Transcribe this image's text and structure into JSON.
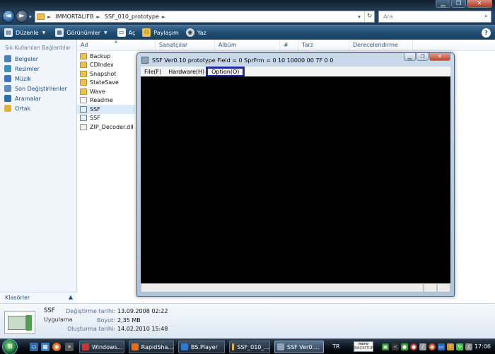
{
  "window": {
    "minimize": "▁",
    "maximize": "❐",
    "close": "✕"
  },
  "address": {
    "crumbs": [
      "IMMORTALIFB",
      "SSF_010_prototype"
    ],
    "arrow": "►",
    "dropdown": "▾",
    "refresh": "↻"
  },
  "search": {
    "placeholder": "Ara",
    "icon": "magnifier-icon"
  },
  "nav_buttons": {
    "back": "◄",
    "forward": "►",
    "history": "▾"
  },
  "toolbar": {
    "organize": "Düzenle",
    "views": "Görünümler",
    "open": "Aç",
    "share": "Paylaşım",
    "burn": "Yaz",
    "help": "?"
  },
  "sidebar": {
    "header": "Sık Kullanılan Bağlantılar",
    "items": [
      {
        "label": "Belgeler",
        "color": "#4a7fb8"
      },
      {
        "label": "Resimler",
        "color": "#3d8fb5"
      },
      {
        "label": "Müzik",
        "color": "#3f75c0"
      },
      {
        "label": "Son Değiştirilenler",
        "color": "#5c8fbf"
      },
      {
        "label": "Aramalar",
        "color": "#2f6fa8"
      },
      {
        "label": "Ortak",
        "color": "#e0b340"
      }
    ],
    "folders_label": "Klasörler",
    "folders_toggle": "▲"
  },
  "columns": {
    "name": "Ad",
    "artist": "Sanatçılar",
    "album": "Albüm",
    "track": "#",
    "genre": "Tarz",
    "rating": "Derecelendirme",
    "sort_indicator": "▲"
  },
  "files": [
    {
      "name": "Backup",
      "kind": "folder"
    },
    {
      "name": "CDIndex",
      "kind": "folder"
    },
    {
      "name": "Snapshot",
      "kind": "folder"
    },
    {
      "name": "StateSave",
      "kind": "folder"
    },
    {
      "name": "Wave",
      "kind": "folder"
    },
    {
      "name": "Readme",
      "kind": "doc"
    },
    {
      "name": "SSF",
      "kind": "exe"
    },
    {
      "name": "SSF",
      "kind": "exe"
    },
    {
      "name": "ZIP_Decoder.dll",
      "kind": "dll"
    }
  ],
  "selected_index": 6,
  "ssf_window": {
    "title": "SSF Ver0.10 prototype  Field = 0  SprFrm = 0  10 10000  00 7F  0  0",
    "menus": [
      "File(F)",
      "Hardware(H)",
      "Option(O)"
    ],
    "highlighted_menu": 2
  },
  "details": {
    "name": "SSF",
    "type": "Uygulama",
    "modified_label": "Değiştirme tarihi:",
    "modified_value": "13.09.2008 02:22",
    "size_label": "Boyut:",
    "size_value": "2,35 MB",
    "created_label": "Oluşturma tarihi:",
    "created_value": "14.02.2010 15:48"
  },
  "taskbar": {
    "start": "⊞",
    "tasks": [
      {
        "label": "Windows...",
        "icon_color": "#c33"
      },
      {
        "label": "RapidSha...",
        "icon_color": "#e07020"
      },
      {
        "label": "BS.Player",
        "icon_color": "#2a7ad0"
      },
      {
        "label": "SSF_010_...",
        "icon_color": "#e0b340"
      },
      {
        "label": "SSF Ver0....",
        "icon_color": "#8fa3b8"
      }
    ],
    "active_task": 4,
    "language": "TR",
    "nero_label": "nero",
    "nero_sub": "BACKITUP",
    "clock": "17:06",
    "tray_chevron": "<"
  }
}
